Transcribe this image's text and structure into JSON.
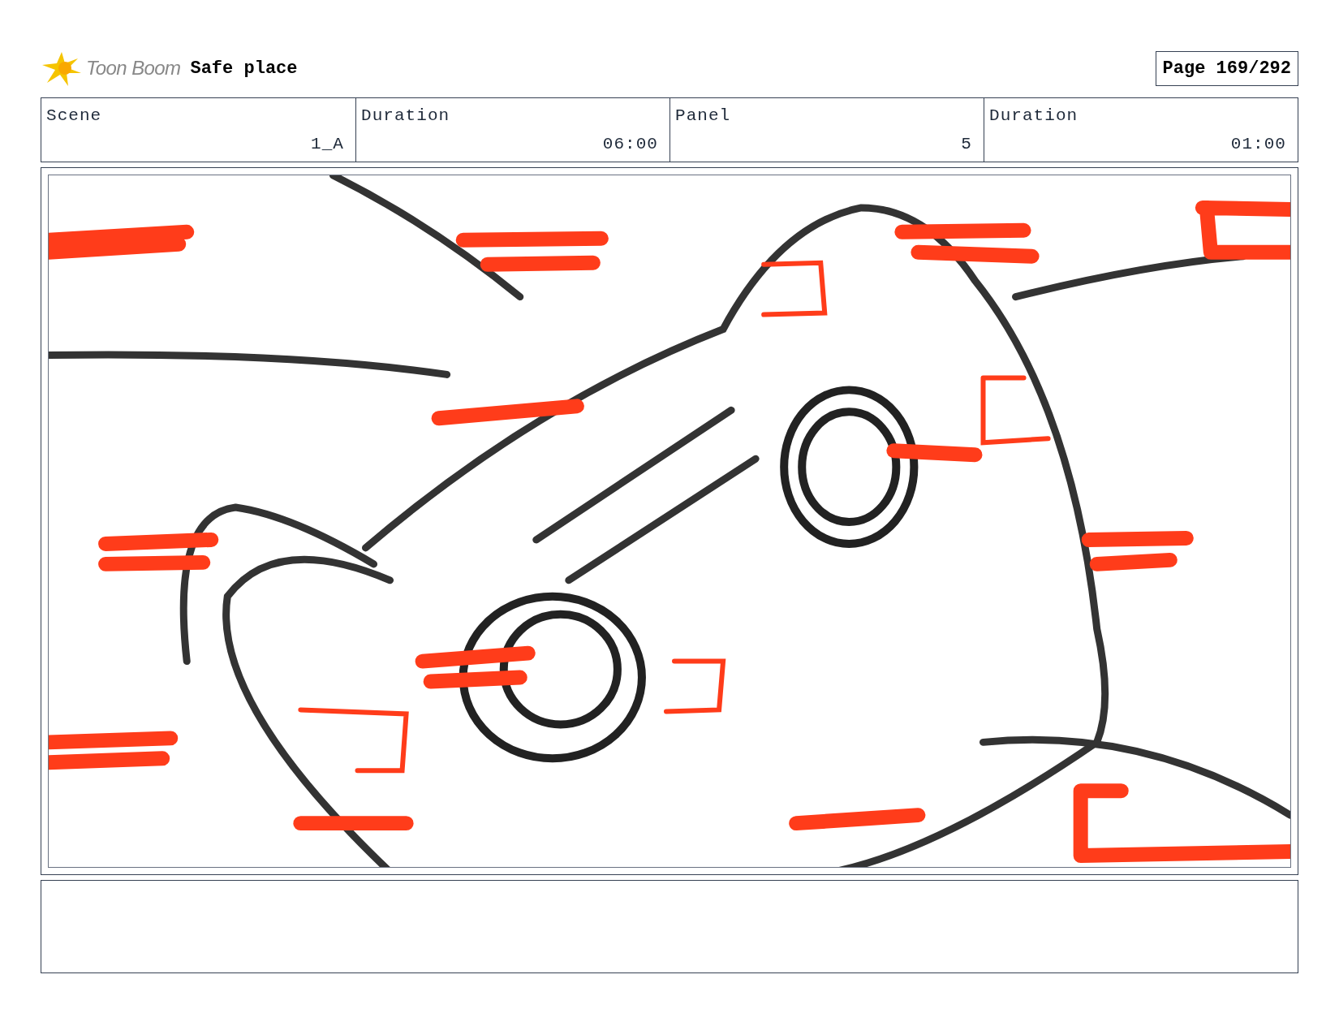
{
  "header": {
    "logo": "Toon Boom",
    "title": "Safe place",
    "page": "Page 169/292"
  },
  "fields": [
    {
      "label": "Scene",
      "value": "1_A"
    },
    {
      "label": "Duration",
      "value": "06:00"
    },
    {
      "label": "Panel",
      "value": "5"
    },
    {
      "label": "Duration",
      "value": "01:00"
    }
  ],
  "panel": {
    "kind": "sketch"
  }
}
